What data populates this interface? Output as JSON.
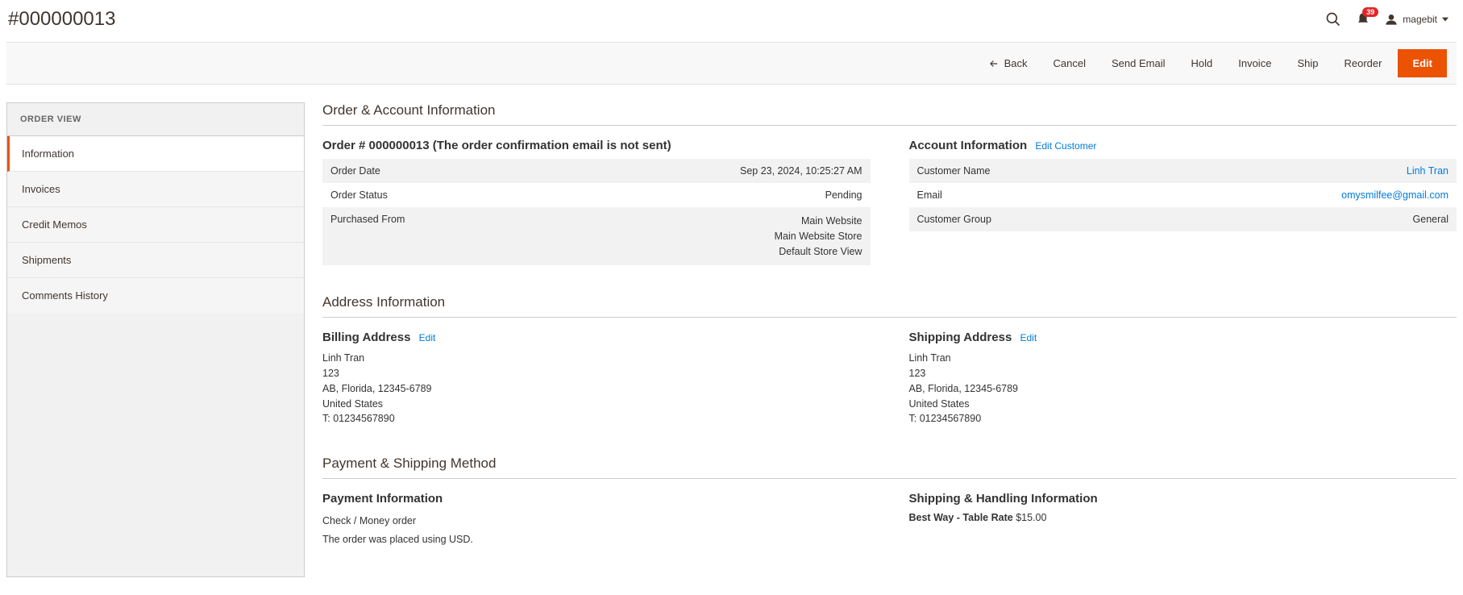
{
  "header": {
    "title": "#000000013",
    "notif_count": "39",
    "username": "magebit"
  },
  "toolbar": {
    "back": "Back",
    "cancel": "Cancel",
    "send_email": "Send Email",
    "hold": "Hold",
    "invoice": "Invoice",
    "ship": "Ship",
    "reorder": "Reorder",
    "edit": "Edit"
  },
  "sidebar": {
    "header": "ORDER VIEW",
    "items": [
      "Information",
      "Invoices",
      "Credit Memos",
      "Shipments",
      "Comments History"
    ]
  },
  "sections": {
    "order_account": "Order & Account Information",
    "address": "Address Information",
    "payment_shipping": "Payment & Shipping Method"
  },
  "order": {
    "title": "Order # 000000013 (The order confirmation email is not sent)",
    "rows": {
      "date_label": "Order Date",
      "date_value": "Sep 23, 2024, 10:25:27 AM",
      "status_label": "Order Status",
      "status_value": "Pending",
      "purchased_label": "Purchased From",
      "purchased_l1": "Main Website",
      "purchased_l2": "Main Website Store",
      "purchased_l3": "Default Store View"
    }
  },
  "account": {
    "title": "Account Information",
    "edit": "Edit Customer",
    "rows": {
      "name_label": "Customer Name",
      "name_value": "Linh Tran",
      "email_label": "Email",
      "email_value": "omysmilfee@gmail.com",
      "group_label": "Customer Group",
      "group_value": "General"
    }
  },
  "billing": {
    "title": "Billing Address",
    "edit": "Edit",
    "lines": [
      "Linh Tran",
      "123",
      "AB, Florida, 12345-6789",
      "United States",
      "T: 01234567890"
    ]
  },
  "shipping": {
    "title": "Shipping Address",
    "edit": "Edit",
    "lines": [
      "Linh Tran",
      "123",
      "AB, Florida, 12345-6789",
      "United States",
      "T: 01234567890"
    ]
  },
  "payment": {
    "title": "Payment Information",
    "method": "Check / Money order",
    "currency": "The order was placed using USD."
  },
  "shipping_info": {
    "title": "Shipping & Handling Information",
    "method": "Best Way - Table Rate",
    "amount": "$15.00"
  }
}
